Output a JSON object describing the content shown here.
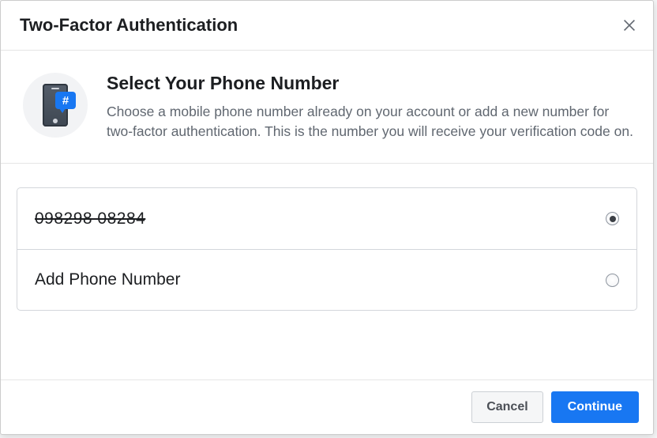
{
  "header": {
    "title": "Two-Factor Authentication"
  },
  "intro": {
    "heading": "Select Your Phone Number",
    "description": "Choose a mobile phone number already on your account or add a new number for two-factor authentication. This is the number you will receive your verification code on."
  },
  "options": [
    {
      "label": "098298 08284",
      "selected": true,
      "strike": true
    },
    {
      "label": "Add Phone Number",
      "selected": false,
      "strike": false
    }
  ],
  "actions": {
    "cancel": "Cancel",
    "continue": "Continue"
  }
}
